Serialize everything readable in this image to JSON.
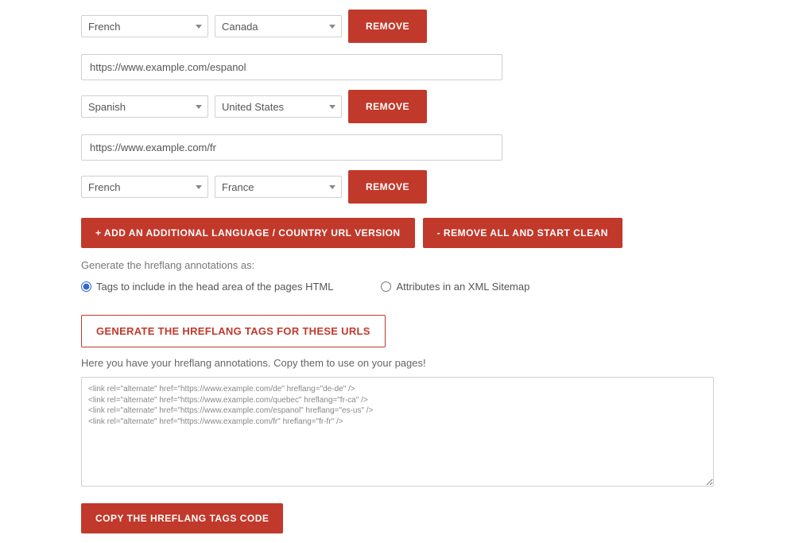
{
  "entries": [
    {
      "language": "French",
      "country": "Canada",
      "remove": "REMOVE"
    },
    {
      "url": "https://www.example.com/espanol",
      "language": "Spanish",
      "country": "United States",
      "remove": "REMOVE"
    },
    {
      "url": "https://www.example.com/fr",
      "language": "French",
      "country": "France",
      "remove": "REMOVE"
    }
  ],
  "actions": {
    "add": "+ ADD AN ADDITIONAL LANGUAGE / COUNTRY URL VERSION",
    "clear": "- REMOVE ALL AND START CLEAN"
  },
  "generateLabel": "Generate the hreflang annotations as:",
  "radio": {
    "head": "Tags to include in the head area of the pages HTML",
    "xml": "Attributes in an XML Sitemap"
  },
  "generateBtn": "GENERATE THE HREFLANG TAGS FOR THESE URLS",
  "helpText": "Here you have your hreflang annotations. Copy them to use on your pages!",
  "output": "<link rel=\"alternate\" href=\"https://www.example.com/de\" hreflang=\"de-de\" />\n<link rel=\"alternate\" href=\"https://www.example.com/quebec\" hreflang=\"fr-ca\" />\n<link rel=\"alternate\" href=\"https://www.example.com/espanol\" hreflang=\"es-us\" />\n<link rel=\"alternate\" href=\"https://www.example.com/fr\" hreflang=\"fr-fr\" />",
  "copyBtn": "COPY THE HREFLANG TAGS CODE"
}
